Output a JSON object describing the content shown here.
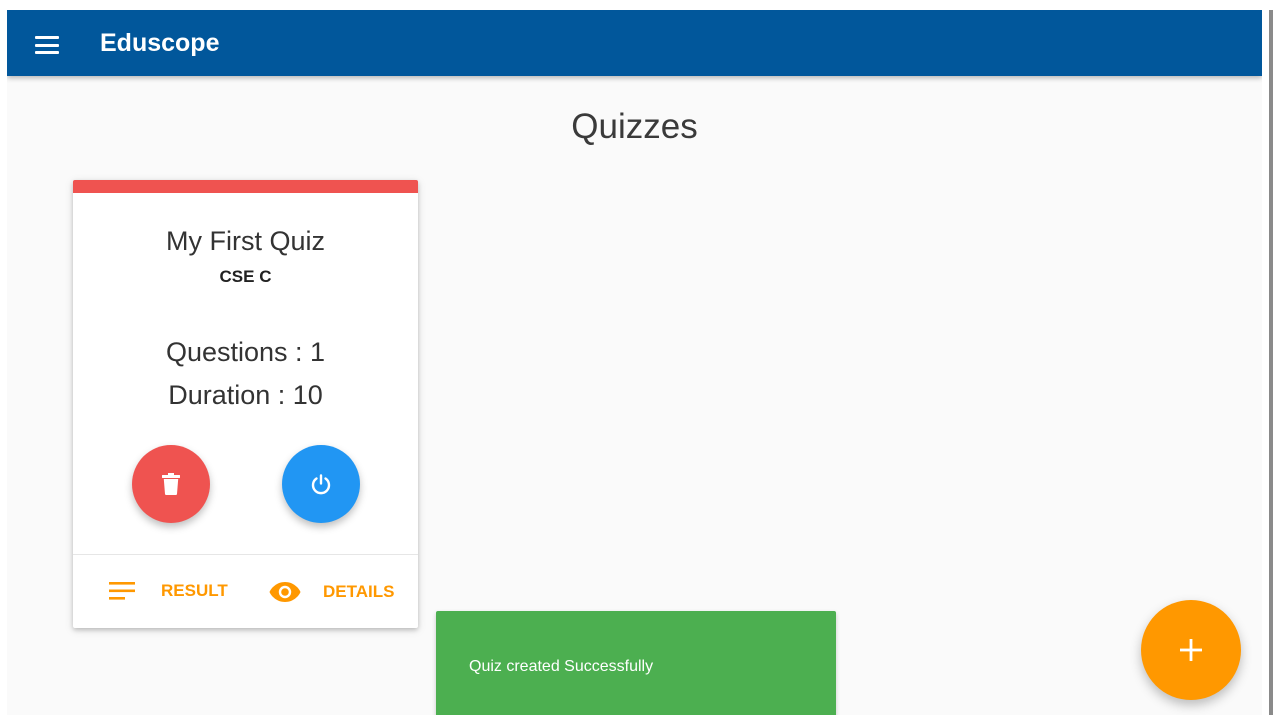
{
  "appbar": {
    "title": "Eduscope",
    "menu_icon": "hamburger-menu-icon",
    "background": "#01579b"
  },
  "page": {
    "title": "Quizzes"
  },
  "quiz_card": {
    "accent": "#ef5350",
    "name": "My First Quiz",
    "class_name": "CSE C",
    "questions_text": "Questions : 1",
    "duration_text": "Duration : 10",
    "delete_icon": "trash-icon",
    "delete_color": "#ef5350",
    "power_icon": "power-icon",
    "power_color": "#2196f3",
    "actions": {
      "result_label": "RESULT",
      "result_icon": "list-lines-icon",
      "details_label": "DETAILS",
      "details_icon": "eye-icon",
      "color": "#ff9800"
    }
  },
  "toast": {
    "message": "Quiz created Successfully",
    "color": "#4caf50"
  },
  "fab": {
    "icon": "plus-icon",
    "color": "#ff9800"
  }
}
